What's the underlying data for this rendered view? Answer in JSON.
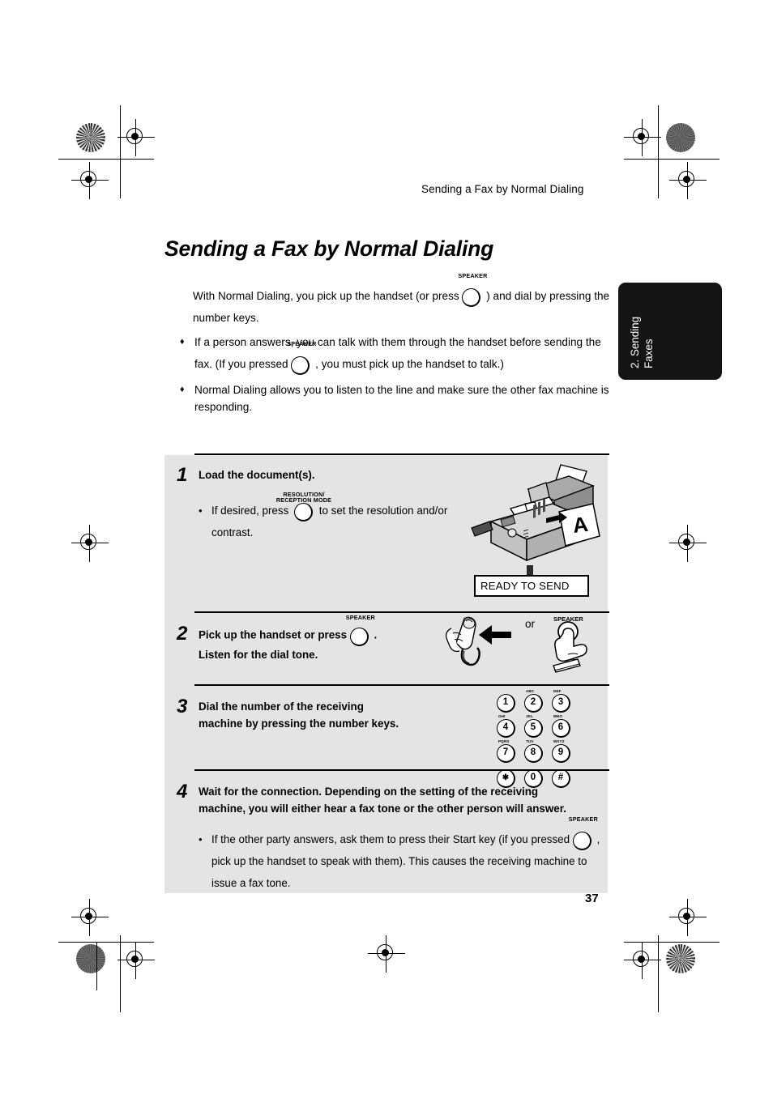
{
  "running_head": "Sending a Fax by Normal Dialing",
  "page_title": "Sending a Fax by Normal Dialing",
  "page_number": "37",
  "side_tab": {
    "line1": "2. Sending",
    "line2": "Faxes"
  },
  "intro": {
    "text_before_key": "With Normal Dialing, you pick up the handset (or press",
    "key_label": "SPEAKER",
    "text_after_key": ") and dial by pressing the number keys."
  },
  "bullets": [
    {
      "marker": "♦",
      "text_before_key": "If a person answers, you can talk with them through the handset before sending the fax. (If you pressed",
      "key_label": "SPEAKER",
      "text_after_key": ", you must pick up the handset to talk.)"
    },
    {
      "marker": "♦",
      "text_before_key": "Normal Dialing allows you to listen to the line and make sure the other fax machine is responding.",
      "key_label": "",
      "text_after_key": ""
    }
  ],
  "steps": [
    {
      "number": "1",
      "heading": "Load the document(s).",
      "sub_marker": "•",
      "sub_before_key": "If desired, press",
      "sub_key_label_line1": "RESOLUTION/",
      "sub_key_label_line2": "RECEPTION MODE",
      "sub_after_key": "to set the resolution and/or contrast.",
      "display_text": "READY TO SEND"
    },
    {
      "number": "2",
      "heading_before_key": "Pick up the handset or press",
      "heading_key_label": "SPEAKER",
      "heading_after_key": ".",
      "heading_line2": "Listen for the dial tone.",
      "or_label": "or",
      "press_key_label": "SPEAKER"
    },
    {
      "number": "3",
      "heading_line1": "Dial the number of the receiving",
      "heading_line2": "machine by pressing the number keys.",
      "keypad": [
        [
          {
            "digit": "1",
            "letters": ""
          },
          {
            "digit": "2",
            "letters": "ABC"
          },
          {
            "digit": "3",
            "letters": "DEF"
          }
        ],
        [
          {
            "digit": "4",
            "letters": "GHI"
          },
          {
            "digit": "5",
            "letters": "JKL"
          },
          {
            "digit": "6",
            "letters": "MNO"
          }
        ],
        [
          {
            "digit": "7",
            "letters": "PQRS"
          },
          {
            "digit": "8",
            "letters": "TUV"
          },
          {
            "digit": "9",
            "letters": "WXYZ"
          }
        ],
        [
          {
            "digit": "✱",
            "letters": ""
          },
          {
            "digit": "0",
            "letters": ""
          },
          {
            "digit": "#",
            "letters": ""
          }
        ]
      ]
    },
    {
      "number": "4",
      "heading_line1": "Wait for the connection. Depending on the setting of the receiving",
      "heading_line2": "machine, you will either hear a fax tone or the other person will answer.",
      "sub_marker": "•",
      "sub_before_key": "If the other party answers, ask them to press their Start key (if you pressed",
      "sub_key_label": "SPEAKER",
      "sub_after_key": ", pick up the handset to speak with them). This causes the receiving machine to issue a fax tone."
    }
  ],
  "colors": {
    "panel_gray": "#e4e4e4",
    "tab_black": "#141414",
    "ink": "#000000"
  }
}
